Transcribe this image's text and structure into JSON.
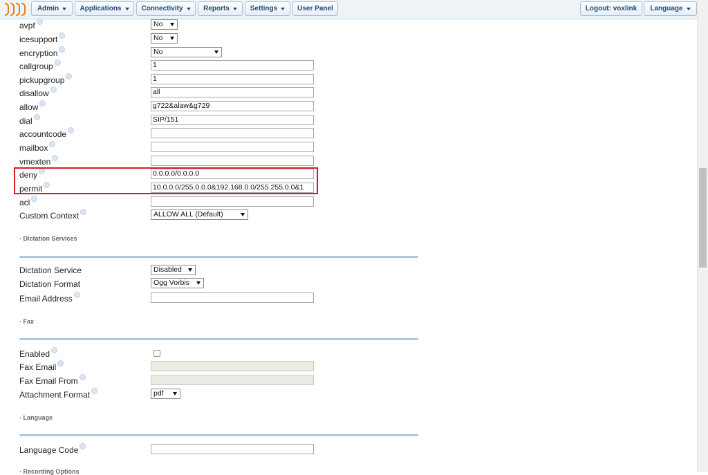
{
  "nav": {
    "left": [
      {
        "label": "Admin",
        "dropdown": true
      },
      {
        "label": "Applications",
        "dropdown": true
      },
      {
        "label": "Connectivity",
        "dropdown": true
      },
      {
        "label": "Reports",
        "dropdown": true
      },
      {
        "label": "Settings",
        "dropdown": true
      },
      {
        "label": "User Panel",
        "dropdown": false
      }
    ],
    "logout": "Logout: voxlink",
    "language": "Language"
  },
  "rows": {
    "avpf": {
      "label": "avpf",
      "value": "No"
    },
    "icesupport": {
      "label": "icesupport",
      "value": "No"
    },
    "encryption": {
      "label": "encryption",
      "value": "No"
    },
    "callgroup": {
      "label": "callgroup",
      "value": "1"
    },
    "pickupgroup": {
      "label": "pickupgroup",
      "value": "1"
    },
    "disallow": {
      "label": "disallow",
      "value": "all"
    },
    "allow": {
      "label": "allow",
      "value": "g722&alaw&g729"
    },
    "dial": {
      "label": "dial",
      "value": "SIP/151"
    },
    "accountcode": {
      "label": "accountcode",
      "value": ""
    },
    "mailbox": {
      "label": "mailbox",
      "value": ""
    },
    "vmexten": {
      "label": "vmexten",
      "value": ""
    },
    "deny": {
      "label": "deny",
      "value": "0.0.0.0/0.0.0.0"
    },
    "permit": {
      "label": "permit",
      "value": "10.0.0.0/255.0.0.0&192.168.0.0/255.255.0.0&1"
    },
    "acl": {
      "label": "acl",
      "value": ""
    },
    "custom_context": {
      "label": "Custom Context",
      "value": "ALLOW ALL (Default)"
    }
  },
  "dictation": {
    "title": "- Dictation Services",
    "service": {
      "label": "Dictation Service",
      "value": "Disabled"
    },
    "format": {
      "label": "Dictation Format",
      "value": "Ogg Vorbis"
    },
    "email": {
      "label": "Email Address",
      "value": ""
    }
  },
  "fax": {
    "title": "- Fax",
    "enabled": {
      "label": "Enabled",
      "checked": false
    },
    "email": {
      "label": "Fax Email",
      "value": ""
    },
    "email_from": {
      "label": "Fax Email From",
      "value": ""
    },
    "attachment": {
      "label": "Attachment Format",
      "value": "pdf"
    }
  },
  "language": {
    "title": "- Language",
    "code": {
      "label": "Language Code",
      "value": ""
    }
  },
  "recording": {
    "title": "- Recording Options"
  },
  "colors": {
    "highlight": "#d21f1f",
    "nav_text": "#234a73",
    "logo": "#f07a12"
  }
}
